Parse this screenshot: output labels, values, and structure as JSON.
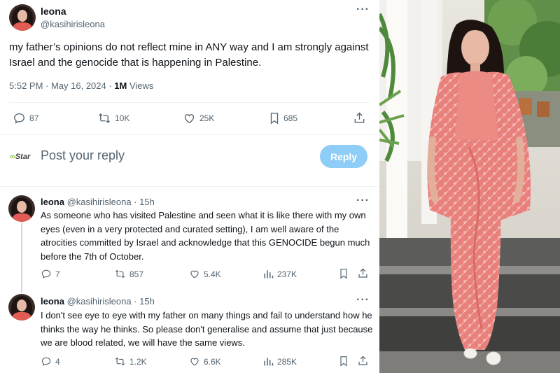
{
  "main_tweet": {
    "name": "leona",
    "handle": "@kasihirisleona",
    "text": "my father’s opinions do not reflect mine in ANY way and I am strongly against Israel and the genocide that is happening in Palestine.",
    "time": "5:52 PM · May 16, 2024 · ",
    "views_count": "1M",
    "views_label": " Views",
    "replies": "87",
    "retweets": "10K",
    "likes": "25K",
    "bookmarks": "685"
  },
  "reply_box": {
    "logo_prefix": "∞",
    "logo_text": "Star",
    "placeholder": "Post your reply",
    "button": "Reply"
  },
  "replies": [
    {
      "name": "leona",
      "handle": "@kasihirisleona · 15h",
      "text": "As someone who has visited Palestine and seen what it is like there with my own eyes (even in a very protected and curated setting), I am well aware of the atrocities committed by Israel and acknowledge that this GENOCIDE begun much before the 7th of October.",
      "replies": "7",
      "retweets": "857",
      "likes": "5.4K",
      "views": "237K"
    },
    {
      "name": "leona",
      "handle": "@kasihirisleona · 15h",
      "text": "I don't see eye to eye with my father on many things and fail to understand how he thinks the way he thinks. So please don't generalise and assume that just because we are blood related, we will have the same views.",
      "replies": "4",
      "retweets": "1.2K",
      "likes": "6.6K",
      "views": "285K"
    }
  ],
  "more_icon": "more-dots-icon",
  "colors": {
    "text_primary": "#0f1419",
    "text_secondary": "#536471",
    "reply_button": "#8ecdf7",
    "divider": "#eff3f4",
    "dress": "#e9837e"
  }
}
